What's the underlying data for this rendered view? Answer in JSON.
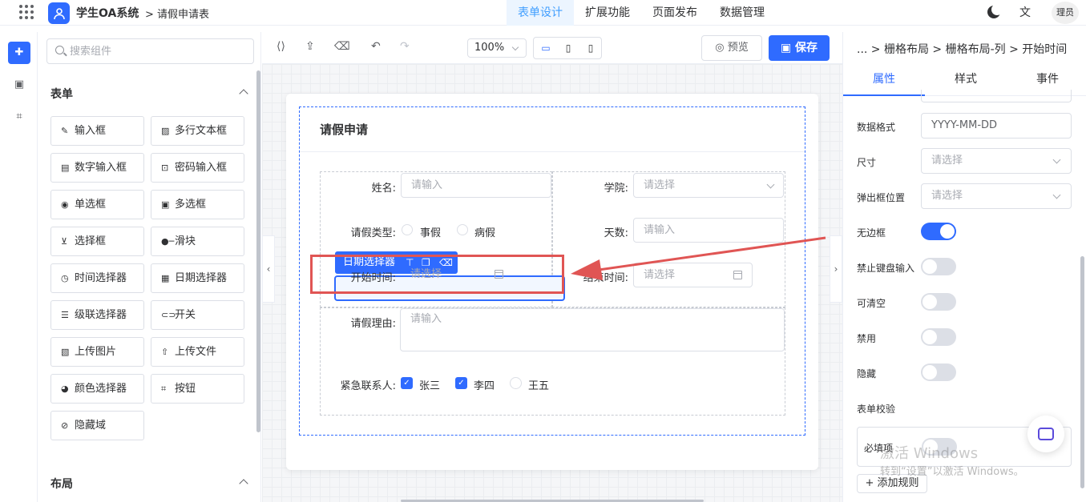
{
  "app": {
    "title": "学生OA系统",
    "crumb": "> 请假申请表"
  },
  "topnav": [
    "表单设计",
    "扩展功能",
    "页面发布",
    "数据管理"
  ],
  "user": {
    "avatar_text": "理员"
  },
  "sidebar_search": {
    "placeholder": "搜索组件"
  },
  "groups": {
    "form": "表单",
    "layout": "布局"
  },
  "components": [
    "输入框",
    "多行文本框",
    "数字输入框",
    "密码输入框",
    "单选框",
    "多选框",
    "选择框",
    "滑块",
    "时间选择器",
    "日期选择器",
    "级联选择器",
    "开关",
    "上传图片",
    "上传文件",
    "颜色选择器",
    "按钮",
    "隐藏域"
  ],
  "toolbar": {
    "zoom": "100%",
    "preview": "预览",
    "save": "保存"
  },
  "form": {
    "title": "请假申请",
    "name_label": "姓名:",
    "name_placeholder": "请输入",
    "college_label": "学院:",
    "college_placeholder": "请选择",
    "leave_type_label": "请假类型:",
    "leave_options": [
      "事假",
      "病假"
    ],
    "days_label": "天数:",
    "days_placeholder": "请输入",
    "start_label": "开始时间:",
    "start_placeholder": "请选择",
    "end_label": "结束时间:",
    "end_placeholder": "请选择",
    "reason_label": "请假理由:",
    "reason_placeholder": "请输入",
    "contact_label": "紧急联系人:",
    "contacts": [
      {
        "name": "张三",
        "checked": true
      },
      {
        "name": "李四",
        "checked": true
      },
      {
        "name": "王五",
        "checked": false
      }
    ],
    "selected_tag": "日期选择器"
  },
  "props": {
    "crumb": "... > 栅格布局 > 栅格布局-列 > 开始时间",
    "tabs": [
      "属性",
      "样式",
      "事件"
    ],
    "date_format_label": "数据格式",
    "date_format_value": "YYYY-MM-DD",
    "size_label": "尺寸",
    "size_placeholder": "请选择",
    "popup_label": "弹出框位置",
    "popup_placeholder": "请选择",
    "borderless_label": "无边框",
    "borderless": true,
    "no_keyboard_label": "禁止键盘输入",
    "no_keyboard": false,
    "clearable_label": "可清空",
    "clearable": false,
    "disabled_label": "禁用",
    "disabled": false,
    "hidden_label": "隐藏",
    "hidden": false,
    "validation_label": "表单校验",
    "required_label": "必填项",
    "required": false,
    "add_rule": "+ 添加规则"
  },
  "watermark": {
    "line1": "激活 Windows",
    "line2": "转到“设置”以激活 Windows。"
  },
  "colors": {
    "primary": "#2f6bff",
    "highlight": "#e05554"
  }
}
